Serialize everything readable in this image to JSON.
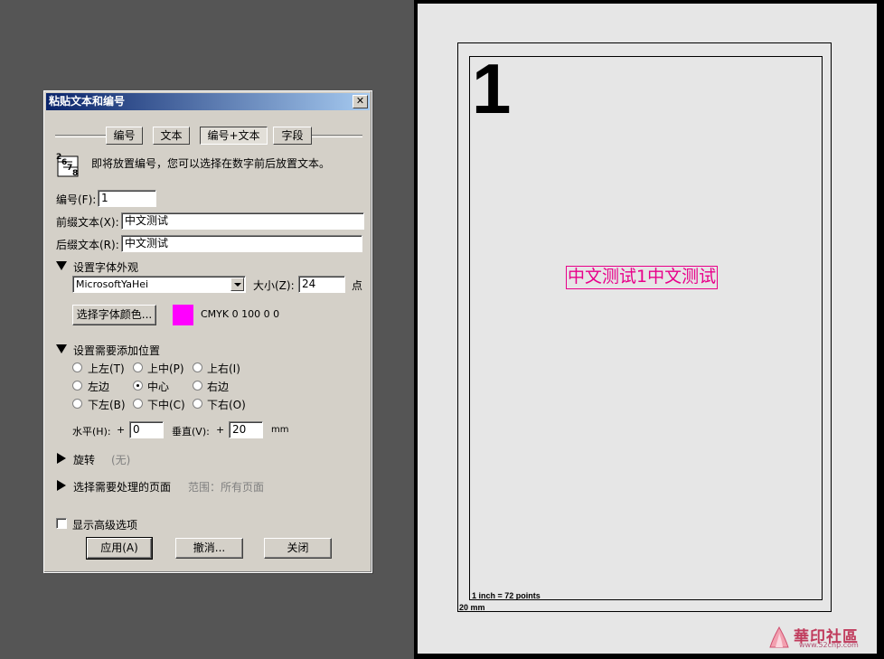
{
  "dialog": {
    "title": "粘贴文本和编号",
    "close_glyph": "✕",
    "tabs": [
      {
        "label": "编号",
        "active": false
      },
      {
        "label": "文本",
        "active": false
      },
      {
        "label": "编号+文本",
        "active": true
      },
      {
        "label": "字段",
        "active": false
      }
    ],
    "description": "即将放置编号，您可以选择在数字前后放置文本。",
    "icon_digits": "2 6 7 8",
    "number": {
      "label": "编号(F):",
      "value": "1"
    },
    "prefix": {
      "label": "前缀文本(X):",
      "value": "中文测试"
    },
    "suffix": {
      "label": "后缀文本(R):",
      "value": "中文测试"
    },
    "font_section": {
      "header": "设置字体外观",
      "font_name": "MicrosoftYaHei",
      "size_label": "大小(Z):",
      "size_value": "24",
      "size_unit": "点",
      "color_button": "选择字体颜色...",
      "color_swatch": "#ff00ff",
      "color_text": "CMYK 0 100 0 0"
    },
    "position_section": {
      "header": "设置需要添加位置",
      "options": [
        {
          "label": "上左(T)",
          "checked": false
        },
        {
          "label": "上中(P)",
          "checked": false
        },
        {
          "label": "上右(I)",
          "checked": false
        },
        {
          "label": "左边",
          "checked": false
        },
        {
          "label": "中心",
          "checked": true
        },
        {
          "label": "右边",
          "checked": false
        },
        {
          "label": "下左(B)",
          "checked": false
        },
        {
          "label": "下中(C)",
          "checked": false
        },
        {
          "label": "下右(O)",
          "checked": false
        }
      ],
      "horizontal_label": "水平(H):",
      "horizontal_sign": "+",
      "horizontal_value": "0",
      "vertical_label": "垂直(V):",
      "vertical_sign": "+",
      "vertical_value": "20",
      "unit": "mm"
    },
    "rotation": {
      "header": "旋转",
      "value": "(无)"
    },
    "pages": {
      "header": "选择需要处理的页面",
      "range": "范围：所有页面"
    },
    "advanced": {
      "label": "显示高级选项",
      "checked": false
    },
    "buttons": {
      "apply": "应用(A)",
      "cancel": "撤消...",
      "close": "关闭"
    }
  },
  "preview": {
    "page_number": "1",
    "stamp_text": "中文测试1中文测试",
    "stamp_color": "#e8008a",
    "scale_note": "1 inch = 72 points",
    "margin_note": "20 mm",
    "watermark_name": "華印社區",
    "watermark_url": "www.52cnp.com"
  }
}
